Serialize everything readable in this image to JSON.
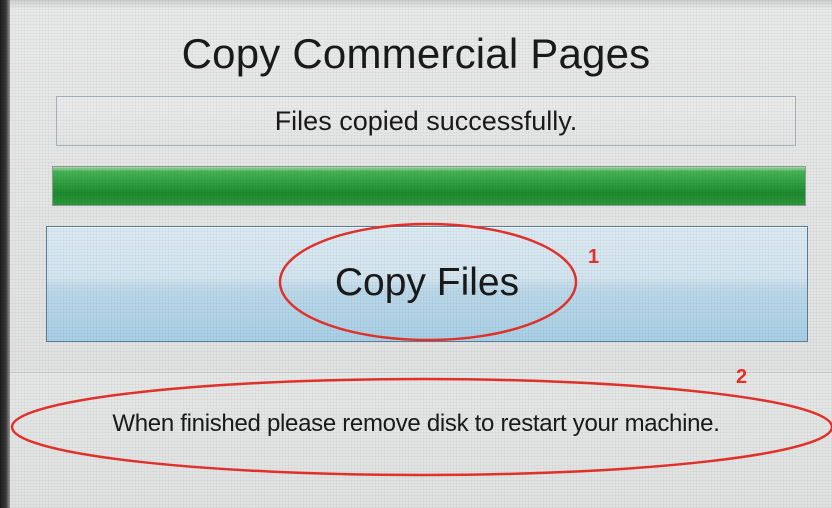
{
  "window": {
    "title": "Copy Commercial Pages"
  },
  "status": {
    "message": "Files copied successfully."
  },
  "progress": {
    "fraction": 1.0
  },
  "actions": {
    "copy_files_label": "Copy Files"
  },
  "footer": {
    "instruction": "When finished please remove disk to restart your machine."
  },
  "annotations": [
    {
      "label": "1",
      "target": "Copy Files"
    },
    {
      "label": "2",
      "target": "When finished please remove disk to restart your machine."
    }
  ],
  "colors": {
    "progress_green": "#2d9e3e",
    "button_blue": "#a9d0e6",
    "annotation_red": "#e0302a"
  }
}
